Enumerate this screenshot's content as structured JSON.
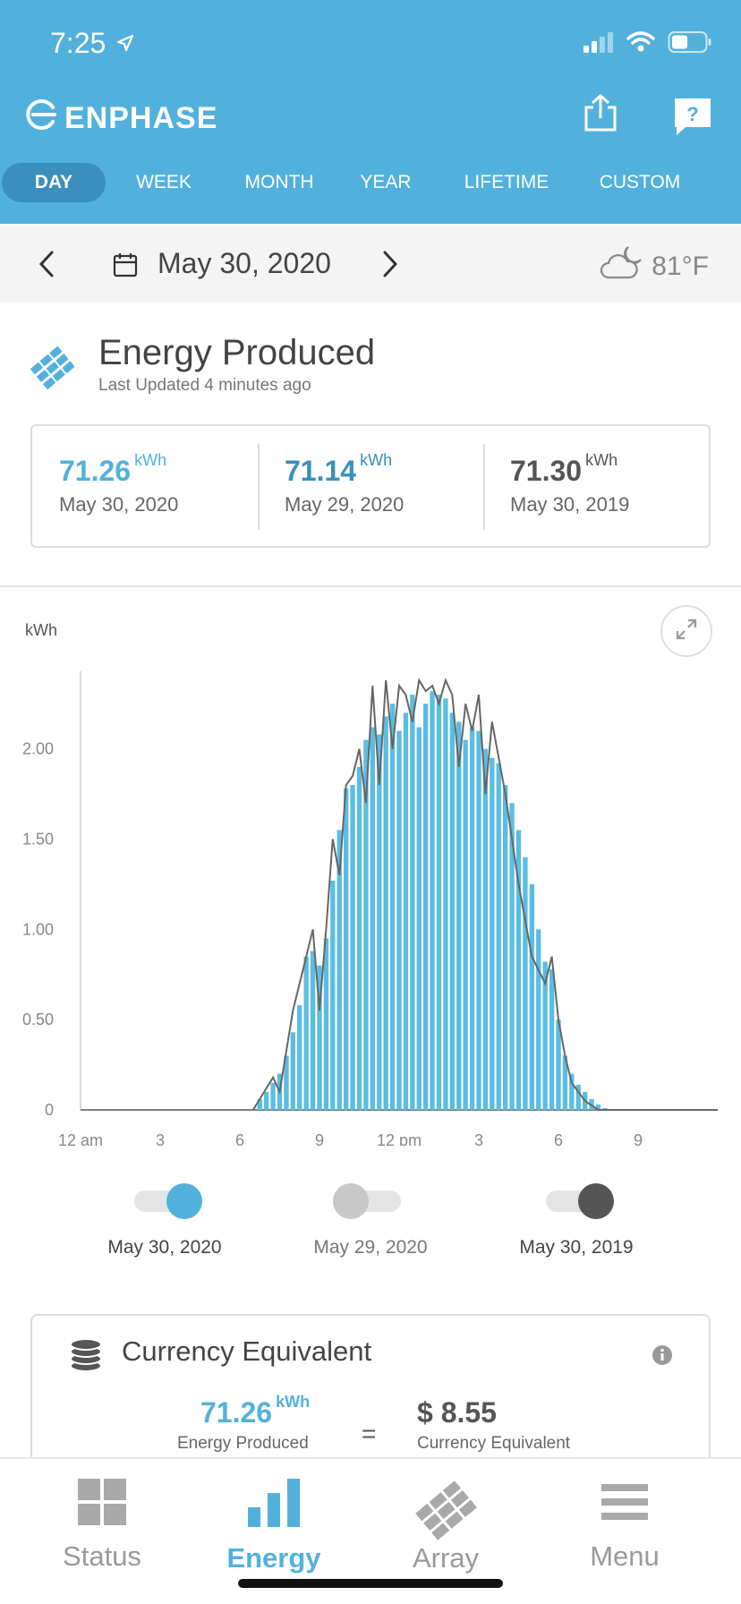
{
  "status_bar": {
    "time": "7:25"
  },
  "header": {
    "brand": "ENPHASE",
    "tabs": [
      {
        "label": "DAY",
        "active": true
      },
      {
        "label": "WEEK",
        "active": false
      },
      {
        "label": "MONTH",
        "active": false
      },
      {
        "label": "YEAR",
        "active": false
      },
      {
        "label": "LIFETIME",
        "active": false
      },
      {
        "label": "CUSTOM",
        "active": false
      }
    ],
    "icons": [
      "share-icon",
      "help-icon"
    ]
  },
  "date_bar": {
    "date": "May 30, 2020",
    "temperature": "81°F",
    "weather_icon": "cloudy-night-icon"
  },
  "energy_produced": {
    "title": "Energy Produced",
    "last_updated": "Last Updated 4 minutes ago",
    "summary": [
      {
        "value": "71.26",
        "unit": "kWh",
        "date": "May 30, 2020",
        "color": "#52b1dc"
      },
      {
        "value": "71.14",
        "unit": "kWh",
        "date": "May 29, 2020",
        "color": "#3a8fbd"
      },
      {
        "value": "71.30",
        "unit": "kWh",
        "date": "May 30, 2019",
        "color": "#555555"
      }
    ]
  },
  "chart_data": {
    "type": "bar",
    "ylabel": "kWh",
    "ylim": [
      0,
      2.4
    ],
    "yticks": [
      "0",
      "0.50",
      "1.00",
      "1.50",
      "2.00"
    ],
    "xtick_labels": [
      "12 am",
      "3",
      "6",
      "9",
      "12 pm",
      "3",
      "6",
      "9"
    ],
    "x_unit": "hour of day",
    "legend": [
      {
        "name": "May 30, 2020",
        "color": "#52b1dc",
        "on": true
      },
      {
        "name": "May 29, 2020",
        "color": "#c8c8c8",
        "on": false
      },
      {
        "name": "May 30, 2019",
        "color": "#555555",
        "on": true
      }
    ],
    "series": [
      {
        "name": "May 30, 2020",
        "style": "bars",
        "color": "#5bbde2",
        "x": [
          6.75,
          7.0,
          7.25,
          7.5,
          7.75,
          8.0,
          8.25,
          8.5,
          8.75,
          9.0,
          9.25,
          9.5,
          9.75,
          10.0,
          10.25,
          10.5,
          10.75,
          11.0,
          11.25,
          11.5,
          11.75,
          12.0,
          12.25,
          12.5,
          12.75,
          13.0,
          13.25,
          13.5,
          13.75,
          14.0,
          14.25,
          14.5,
          14.75,
          15.0,
          15.25,
          15.5,
          15.75,
          16.0,
          16.25,
          16.5,
          16.75,
          17.0,
          17.25,
          17.5,
          17.75,
          18.0,
          18.25,
          18.5,
          18.75,
          19.0,
          19.25,
          19.5,
          19.75
        ],
        "values": [
          0.06,
          0.1,
          0.15,
          0.2,
          0.3,
          0.43,
          0.58,
          0.85,
          0.88,
          0.8,
          0.95,
          1.27,
          1.55,
          1.78,
          1.8,
          1.9,
          2.05,
          2.12,
          2.08,
          2.18,
          2.25,
          2.1,
          2.2,
          2.3,
          2.12,
          2.25,
          2.32,
          2.3,
          2.28,
          2.2,
          2.15,
          2.05,
          2.12,
          2.1,
          2.0,
          1.95,
          1.92,
          1.8,
          1.7,
          1.55,
          1.4,
          1.25,
          1.0,
          0.82,
          0.78,
          0.5,
          0.3,
          0.2,
          0.14,
          0.1,
          0.06,
          0.03,
          0.01
        ]
      },
      {
        "name": "May 30, 2019",
        "style": "line",
        "color": "#666666",
        "x": [
          6.5,
          7.25,
          7.5,
          8.0,
          8.5,
          8.75,
          9.0,
          9.25,
          9.5,
          9.75,
          10.0,
          10.25,
          10.5,
          10.75,
          11.0,
          11.25,
          11.5,
          11.75,
          12.0,
          12.25,
          12.5,
          12.75,
          13.0,
          13.25,
          13.5,
          13.75,
          14.0,
          14.25,
          14.5,
          14.75,
          15.0,
          15.25,
          15.5,
          15.75,
          16.0,
          16.5,
          17.0,
          17.5,
          17.75,
          18.0,
          18.25,
          18.5,
          19.0,
          19.5,
          20.0,
          24.0
        ],
        "values": [
          0,
          0.18,
          0.1,
          0.55,
          0.85,
          1.0,
          0.55,
          1.0,
          1.5,
          1.3,
          1.8,
          1.85,
          2.0,
          1.7,
          2.35,
          1.8,
          2.38,
          2.0,
          2.35,
          2.3,
          2.15,
          2.38,
          2.32,
          2.35,
          2.25,
          2.38,
          2.3,
          1.9,
          2.25,
          2.1,
          2.3,
          1.75,
          2.15,
          1.95,
          1.75,
          1.25,
          0.85,
          0.7,
          0.85,
          0.5,
          0.3,
          0.15,
          0.05,
          0.0,
          0.0,
          0.0
        ]
      }
    ]
  },
  "currency": {
    "title": "Currency Equivalent",
    "energy_value": "71.26",
    "energy_unit": "kWh",
    "energy_label": "Energy Produced",
    "equals": "=",
    "money_value": "$ 8.55",
    "money_label": "Currency Equivalent"
  },
  "tab_bar": [
    {
      "label": "Status",
      "icon": "status-grid-icon",
      "active": false
    },
    {
      "label": "Energy",
      "icon": "energy-bars-icon",
      "active": true
    },
    {
      "label": "Array",
      "icon": "array-panels-icon",
      "active": false
    },
    {
      "label": "Menu",
      "icon": "menu-lines-icon",
      "active": false
    }
  ]
}
